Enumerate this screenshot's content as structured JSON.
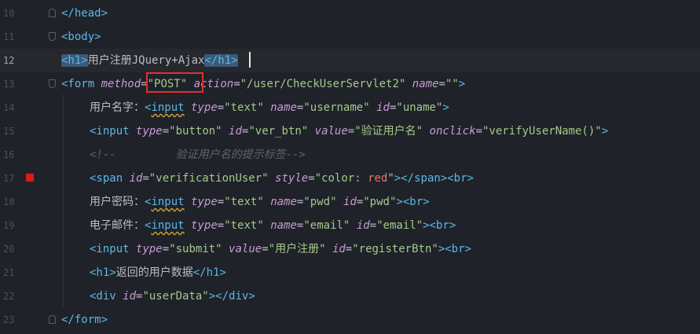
{
  "lines": [
    {
      "num": "10",
      "parts": [
        [
          "tag",
          "</head>"
        ]
      ]
    },
    {
      "num": "11",
      "parts": [
        [
          "tag",
          "<body>"
        ]
      ]
    },
    {
      "num": "12",
      "parts": [
        [
          "tag",
          "<h1>"
        ],
        [
          "text",
          "用户注册JQuery+Ajax"
        ],
        [
          "tag",
          "</h1>"
        ]
      ]
    },
    {
      "num": "13",
      "parts": [
        [
          "tag",
          "<form "
        ],
        [
          "attr",
          "method"
        ],
        [
          "text",
          "="
        ],
        [
          "str",
          "\"POST\""
        ],
        [
          "text",
          " "
        ],
        [
          "attr",
          "action"
        ],
        [
          "text",
          "="
        ],
        [
          "str",
          "\"/user/CheckUserServlet2\""
        ],
        [
          "text",
          " "
        ],
        [
          "attr",
          "name"
        ],
        [
          "text",
          "="
        ],
        [
          "str",
          "\"\""
        ],
        [
          "tag",
          ">"
        ]
      ]
    },
    {
      "num": "14",
      "parts": [
        [
          "text",
          "用户名字："
        ],
        [
          "tag",
          "<input "
        ],
        [
          "attr",
          "type"
        ],
        [
          "text",
          "="
        ],
        [
          "str",
          "\"text\""
        ],
        [
          "text",
          " "
        ],
        [
          "attr",
          "name"
        ],
        [
          "text",
          "="
        ],
        [
          "str",
          "\"username\""
        ],
        [
          "text",
          " "
        ],
        [
          "attr",
          "id"
        ],
        [
          "text",
          "="
        ],
        [
          "str",
          "\"uname\""
        ],
        [
          "tag",
          ">"
        ]
      ]
    },
    {
      "num": "15",
      "parts": [
        [
          "tag",
          "<input "
        ],
        [
          "attr",
          "type"
        ],
        [
          "text",
          "="
        ],
        [
          "str",
          "\"button\""
        ],
        [
          "text",
          " "
        ],
        [
          "attr",
          "id"
        ],
        [
          "text",
          "="
        ],
        [
          "str",
          "\"ver_btn\""
        ],
        [
          "text",
          " "
        ],
        [
          "attr",
          "value"
        ],
        [
          "text",
          "="
        ],
        [
          "str",
          "\"验证用户名\""
        ],
        [
          "text",
          " "
        ],
        [
          "attr",
          "onclick"
        ],
        [
          "text",
          "="
        ],
        [
          "str",
          "\"verifyUserName()\""
        ],
        [
          "tag",
          ">"
        ]
      ]
    },
    {
      "num": "16",
      "parts": [
        [
          "comment",
          "<!--         验证用户名的提示标签-->"
        ]
      ]
    },
    {
      "num": "17",
      "parts": [
        [
          "tag",
          "<span "
        ],
        [
          "attr",
          "id"
        ],
        [
          "text",
          "="
        ],
        [
          "str",
          "\"verificationUser\""
        ],
        [
          "text",
          " "
        ],
        [
          "attr",
          "style"
        ],
        [
          "text",
          "="
        ],
        [
          "str",
          "\"color: "
        ],
        [
          "red",
          "red"
        ],
        [
          "str",
          "\""
        ],
        [
          "tag",
          "></span><br>"
        ]
      ]
    },
    {
      "num": "18",
      "parts": [
        [
          "text",
          "用户密码："
        ],
        [
          "tag",
          "<input "
        ],
        [
          "attr",
          "type"
        ],
        [
          "text",
          "="
        ],
        [
          "str",
          "\"text\""
        ],
        [
          "text",
          " "
        ],
        [
          "attr",
          "name"
        ],
        [
          "text",
          "="
        ],
        [
          "str",
          "\"pwd\""
        ],
        [
          "text",
          " "
        ],
        [
          "attr",
          "id"
        ],
        [
          "text",
          "="
        ],
        [
          "str",
          "\"pwd\""
        ],
        [
          "tag",
          "><br>"
        ]
      ]
    },
    {
      "num": "19",
      "parts": [
        [
          "text",
          "电子邮件："
        ],
        [
          "tag",
          "<input "
        ],
        [
          "attr",
          "type"
        ],
        [
          "text",
          "="
        ],
        [
          "str",
          "\"text\""
        ],
        [
          "text",
          " "
        ],
        [
          "attr",
          "name"
        ],
        [
          "text",
          "="
        ],
        [
          "str",
          "\"email\""
        ],
        [
          "text",
          " "
        ],
        [
          "attr",
          "id"
        ],
        [
          "text",
          "="
        ],
        [
          "str",
          "\"email\""
        ],
        [
          "tag",
          "><br>"
        ]
      ]
    },
    {
      "num": "20",
      "parts": [
        [
          "tag",
          "<input "
        ],
        [
          "attr",
          "type"
        ],
        [
          "text",
          "="
        ],
        [
          "str",
          "\"submit\""
        ],
        [
          "text",
          " "
        ],
        [
          "attr",
          "value"
        ],
        [
          "text",
          "="
        ],
        [
          "str",
          "\"用户注册\""
        ],
        [
          "text",
          " "
        ],
        [
          "attr",
          "id"
        ],
        [
          "text",
          "="
        ],
        [
          "str",
          "\"registerBtn\""
        ],
        [
          "tag",
          "><br>"
        ]
      ]
    },
    {
      "num": "21",
      "parts": [
        [
          "tag",
          "<h1>"
        ],
        [
          "text",
          "返回的用户数据"
        ],
        [
          "tag",
          "</h1>"
        ]
      ]
    },
    {
      "num": "22",
      "parts": [
        [
          "tag",
          "<div "
        ],
        [
          "attr",
          "id"
        ],
        [
          "text",
          "="
        ],
        [
          "str",
          "\"userData\""
        ],
        [
          "tag",
          "></div>"
        ]
      ]
    },
    {
      "num": "23",
      "parts": [
        [
          "tag",
          "</form>"
        ]
      ]
    }
  ],
  "colors": {
    "background": "#1f2229",
    "tag": "#5cb8e6",
    "attribute": "#c79bd5",
    "string": "#a6c98a",
    "breakpoint": "#e01a1a",
    "highlight_box": "#e0302b"
  }
}
